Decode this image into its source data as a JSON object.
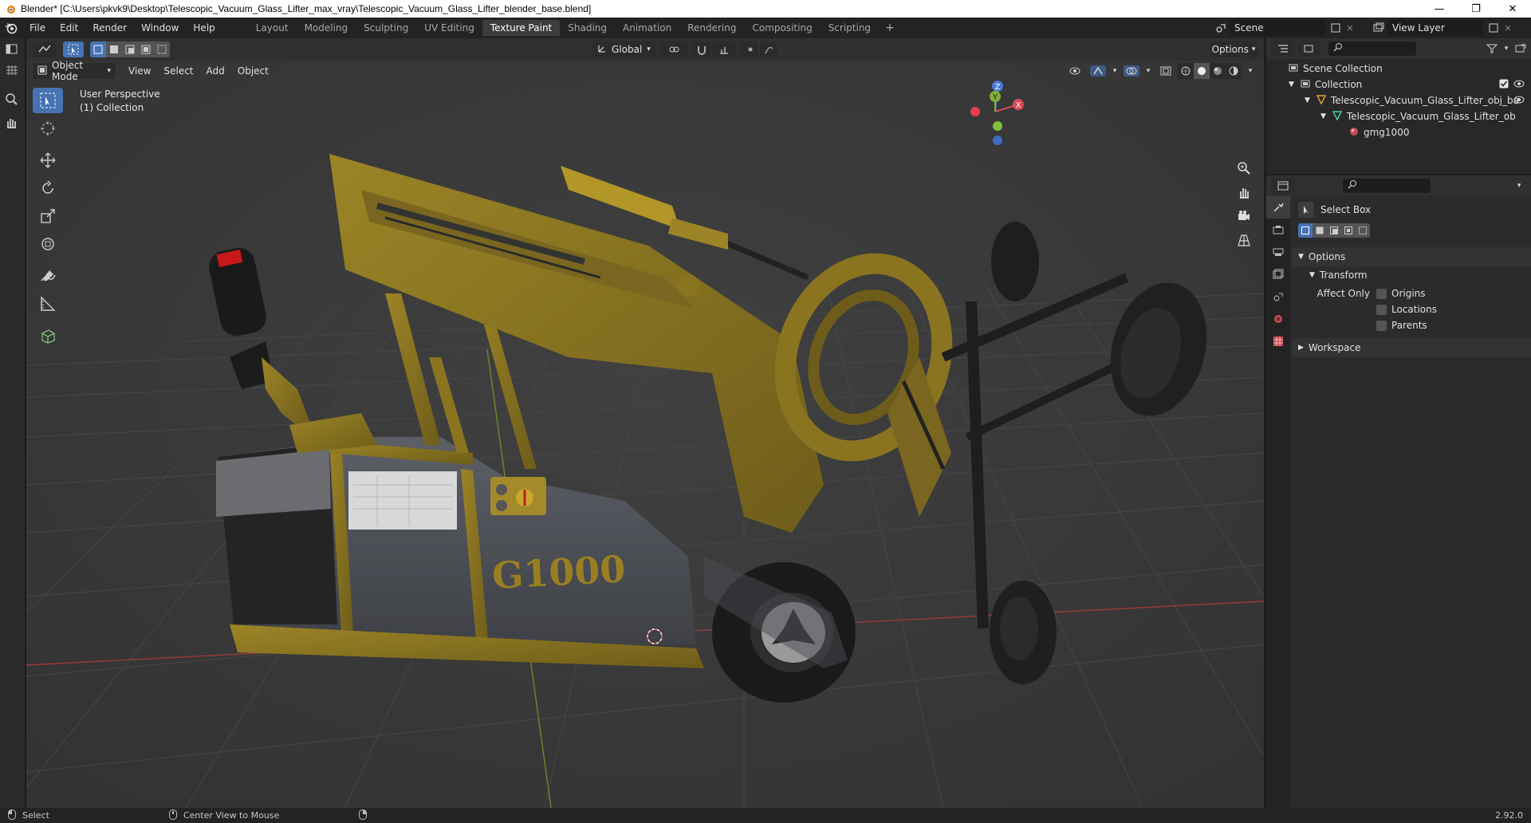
{
  "window": {
    "title": "Blender* [C:\\Users\\pkvk9\\Desktop\\Telescopic_Vacuum_Glass_Lifter_max_vray\\Telescopic_Vacuum_Glass_Lifter_blender_base.blend]",
    "minimize": "—",
    "maximize": "❐",
    "close": "✕"
  },
  "menu": [
    "File",
    "Edit",
    "Render",
    "Window",
    "Help"
  ],
  "workspaces": [
    "Layout",
    "Modeling",
    "Sculpting",
    "UV Editing",
    "Texture Paint",
    "Shading",
    "Animation",
    "Rendering",
    "Compositing",
    "Scripting"
  ],
  "active_workspace": "Texture Paint",
  "add_workspace": "+",
  "scene": {
    "label": "Scene"
  },
  "view_layer": {
    "label": "View Layer"
  },
  "viewport": {
    "options_label": "Options",
    "transform_orientation": "Global",
    "mode": "Object Mode",
    "menus": [
      "View",
      "Select",
      "Add",
      "Object"
    ],
    "perspective_label": "User Perspective",
    "collection_label": "(1) Collection",
    "model_text": "G1000",
    "gizmo": {
      "z": "Z",
      "y": "Y",
      "x": "X"
    }
  },
  "outliner": {
    "items": [
      {
        "label": "Scene Collection",
        "indent": 0
      },
      {
        "label": "Collection",
        "indent": 1
      },
      {
        "label": "Telescopic_Vacuum_Glass_Lifter_obj_ba",
        "indent": 2
      },
      {
        "label": "Telescopic_Vacuum_Glass_Lifter_ob",
        "indent": 3
      },
      {
        "label": "gmg1000",
        "indent": 4
      }
    ]
  },
  "properties": {
    "tool_name": "Select Box",
    "options_label": "Options",
    "transform_label": "Transform",
    "affect_only_label": "Affect Only",
    "checkboxes": [
      "Origins",
      "Locations",
      "Parents"
    ],
    "workspace_label": "Workspace"
  },
  "status": {
    "select": "Select",
    "center_view": "Center View to Mouse",
    "version": "2.92.0"
  },
  "colors": {
    "accent": "#4772b3",
    "yellow_body": "#8a7420",
    "grid_red": "#9c3a3a",
    "grid_green": "#6b8b2b"
  }
}
